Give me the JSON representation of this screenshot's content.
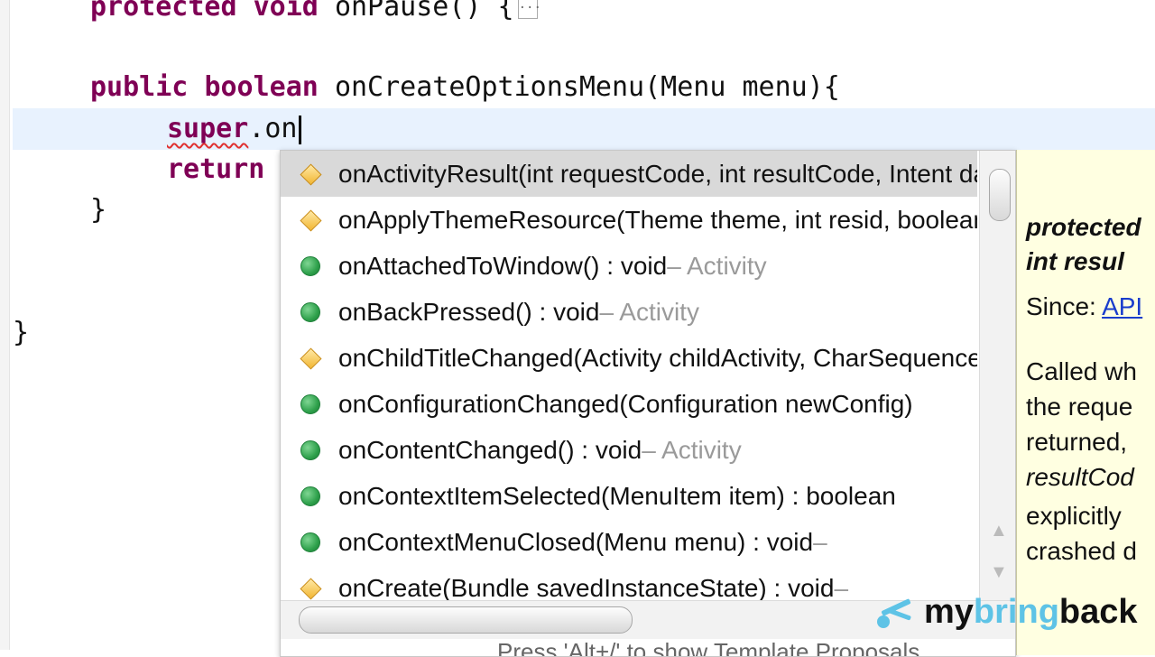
{
  "editor": {
    "lines": [
      {
        "kw1": "protected",
        "kw2": "void",
        "rest": "onPause() {",
        "fold": "..."
      },
      {
        "kw1": "public",
        "kw2": "boolean",
        "rest": "onCreateOptionsMenu(Menu menu){"
      },
      {
        "err": "super",
        "rest": ".on"
      },
      {
        "kw": "return"
      },
      {
        "text": "}"
      },
      {
        "text": "}"
      }
    ]
  },
  "assist": {
    "items": [
      {
        "icon": "protected-method-icon",
        "sig": "onActivityResult(int requestCode, int resultCode, Intent data)",
        "owner": ""
      },
      {
        "icon": "protected-method-icon",
        "sig": "onApplyThemeResource(Theme theme, int resid, boolean first)",
        "owner": ""
      },
      {
        "icon": "public-method-icon",
        "sig": "onAttachedToWindow() : void",
        "owner": " – Activity"
      },
      {
        "icon": "public-method-icon",
        "sig": "onBackPressed() : void",
        "owner": " – Activity"
      },
      {
        "icon": "protected-method-icon",
        "sig": "onChildTitleChanged(Activity childActivity, CharSequence title)",
        "owner": ""
      },
      {
        "icon": "public-method-icon",
        "sig": "onConfigurationChanged(Configuration newConfig)",
        "owner": ""
      },
      {
        "icon": "public-method-icon",
        "sig": "onContentChanged() : void",
        "owner": " – Activity"
      },
      {
        "icon": "public-method-icon",
        "sig": "onContextItemSelected(MenuItem item) : boolean",
        "owner": ""
      },
      {
        "icon": "public-method-icon",
        "sig": "onContextMenuClosed(Menu menu) : void",
        "owner": " –"
      },
      {
        "icon": "protected-method-icon",
        "sig": "onCreate(Bundle savedInstanceState) : void",
        "owner": " –"
      }
    ],
    "status_partial": "Press 'Alt+/' to show Template Proposals"
  },
  "doc": {
    "line1": "protected",
    "line2": "int resul",
    "since_label": "Since: ",
    "since_link": "API",
    "p1": "Called wh",
    "p2": "the reque",
    "p3": "returned,",
    "p4": "resultCod",
    "p5": "explicitly",
    "p6": "crashed d"
  },
  "watermark": {
    "w1": "my",
    "w2": "bring",
    "w3": "back"
  }
}
